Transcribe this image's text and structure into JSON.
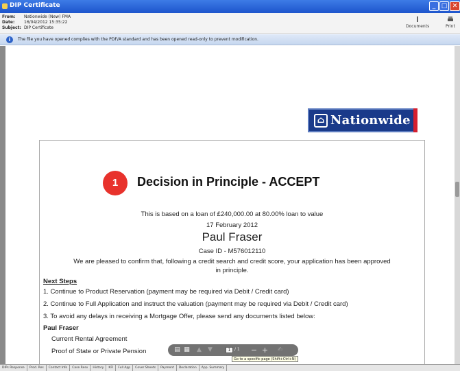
{
  "window": {
    "title": "DIP Certificate"
  },
  "header": {
    "from_label": "From:",
    "from_value": "Nationwide (New) FMA",
    "date_label": "Date:",
    "date_value": "16/04/2012 15:35:22",
    "subject_label": "Subject:",
    "subject_value": "DIP Certificate",
    "documents_label": "Documents",
    "print_label": "Print"
  },
  "infobar": {
    "text": "The file you have opened complies with the PDF/A standard and has been opened read-only to prevent modification."
  },
  "document": {
    "logo_text": "Nationwide",
    "step_badge": "1",
    "heading": "Decision in Principle - ACCEPT",
    "loan_line": "This is based on a loan of £240,000.00 at 80.00% loan to value",
    "date": "17 February 2012",
    "applicant": "Paul Fraser",
    "case_id": "Case ID -  M576012110",
    "confirm_1": "We are pleased to confirm that, following a credit search and credit score, your application has been approved",
    "confirm_2": "in principle.",
    "next_steps_heading": "Next Steps",
    "steps": [
      "1. Continue to Product Reservation (payment may be required via Debit / Credit card)",
      "2. Continue to Full Application and instruct the valuation (payment may be required via Debit / Credit card)",
      "3. To avoid any delays in receiving a Mortgage Offer, please send any documents listed below:"
    ],
    "docs_person": "Paul Fraser",
    "docs": [
      "Current Rental Agreement",
      "Proof of State or Private Pension"
    ]
  },
  "pdf_toolbar": {
    "page_current": "1",
    "page_total": "/ 1",
    "tooltip": "Go to a specific page (Shift+Ctrl+N)"
  },
  "bottom_tabs": [
    "DIPs Response",
    "Prod. Res",
    "Contact Info",
    "Case Resv",
    "History",
    "KFI",
    "Full App",
    "Cover Sheets",
    "Payment",
    "Declaration",
    "App. Summary"
  ]
}
